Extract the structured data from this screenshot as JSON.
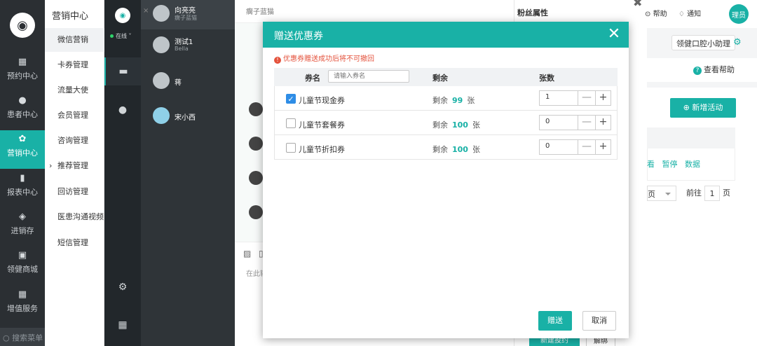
{
  "leftnav": {
    "items": [
      {
        "label": "预约中心",
        "icon": "calendar-icon",
        "active": false
      },
      {
        "label": "患者中心",
        "icon": "user-plus-icon",
        "active": false
      },
      {
        "label": "营销中心",
        "icon": "butterfly-icon",
        "active": true
      },
      {
        "label": "报表中心",
        "icon": "bar-chart-icon",
        "active": false
      },
      {
        "label": "进销存",
        "icon": "layers-icon",
        "active": false
      },
      {
        "label": "领健商城",
        "icon": "shop-icon",
        "active": false
      },
      {
        "label": "增值服务",
        "icon": "grid-icon",
        "active": false
      }
    ],
    "search": "搜索菜单"
  },
  "submenu": {
    "title": "营销中心",
    "items": [
      "微信营销",
      "卡券管理",
      "流量大使",
      "会员管理",
      "咨询管理",
      "推荐管理",
      "回访管理",
      "医患沟通视频",
      "短信管理"
    ]
  },
  "rail": {
    "status": "在线"
  },
  "contacts": [
    {
      "name": "向亮亮",
      "sub": "瘸子蓝猫"
    },
    {
      "name": "测试1",
      "sub": "Bella"
    },
    {
      "name": "蒋",
      "sub": ""
    },
    {
      "name": "宋小西",
      "sub": ""
    }
  ],
  "chat": {
    "header": "瘸子蓝猫",
    "input_placeholder": "在此输"
  },
  "fans": {
    "title": "粉丝属性"
  },
  "header": {
    "help": "帮助",
    "notify": "通知",
    "user": "理员",
    "assistant": "领健口腔小助理",
    "view_help": "查看帮助"
  },
  "panel": {
    "new_activity": "新增活动",
    "ops": [
      "看",
      "暂停",
      "数据"
    ],
    "pager_prefix": "页",
    "goto": "前往",
    "page": "1",
    "page_suffix": "页"
  },
  "peek": {
    "a": "新建投约",
    "b": "解绑"
  },
  "modal": {
    "title": "赠送优惠券",
    "warning": "优惠券赠送成功后将不可撤回",
    "columns": {
      "name": "券名",
      "remaining": "剩余",
      "count": "张数"
    },
    "search_placeholder": "请输入券名",
    "rows": [
      {
        "name": "儿童节现金券",
        "prefix": "剩余",
        "remaining": "99",
        "unit": "张",
        "count": "1",
        "checked": true
      },
      {
        "name": "儿童节套餐券",
        "prefix": "剩余",
        "remaining": "100",
        "unit": "张",
        "count": "0",
        "checked": false
      },
      {
        "name": "儿童节折扣券",
        "prefix": "剩余",
        "remaining": "100",
        "unit": "张",
        "count": "0",
        "checked": false
      }
    ],
    "send": "赠送",
    "cancel": "取消"
  },
  "colors": {
    "accent": "#19b1a6",
    "warning": "#e4523c",
    "check": "#2e8de6"
  }
}
